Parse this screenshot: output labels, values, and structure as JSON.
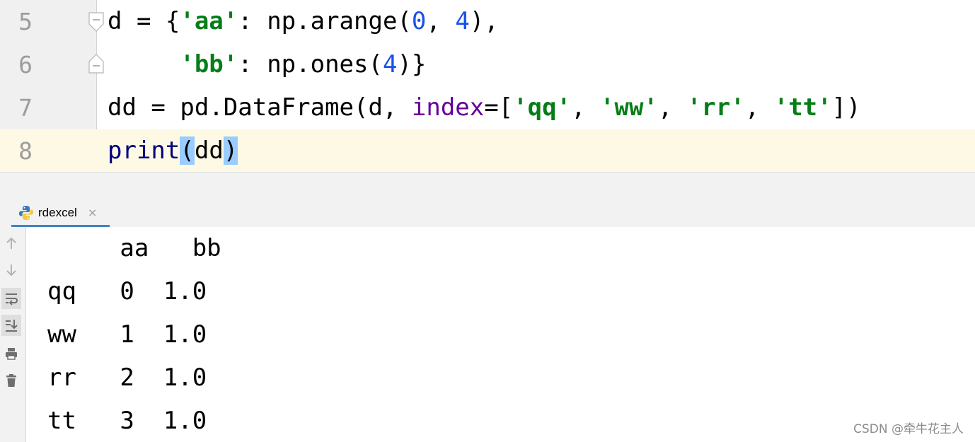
{
  "editor": {
    "lines": [
      {
        "number": "5",
        "tokens": {
          "a": "d = {",
          "b": "'aa'",
          "c": ": np.arange(",
          "d": "0",
          "e": ", ",
          "f": "4",
          "g": "),"
        }
      },
      {
        "number": "6",
        "tokens": {
          "a": "     ",
          "b": "'bb'",
          "c": ": np.ones(",
          "d": "4",
          "e": ")}"
        }
      },
      {
        "number": "7",
        "tokens": {
          "a": "dd = pd.DataFrame(d, ",
          "b": "index",
          "c": "=[",
          "d": "'qq'",
          "e": ", ",
          "f": "'ww'",
          "g": ", ",
          "h": "'rr'",
          "i": ", ",
          "j": "'tt'",
          "k": "])"
        }
      },
      {
        "number": "8",
        "tokens": {
          "a": "print",
          "b": "(",
          "c": "dd",
          "d": ")"
        }
      }
    ]
  },
  "run": {
    "tab_label": "rdexcel",
    "tab_close": "×",
    "output": [
      "     aa   bb",
      "qq   0  1.0",
      "ww   1  1.0",
      "rr   2  1.0",
      "tt   3  1.0"
    ]
  },
  "toolbar_icons": [
    "up-arrow-icon",
    "down-arrow-icon",
    "soft-wrap-icon",
    "scroll-to-end-icon",
    "print-icon",
    "trash-icon"
  ],
  "watermark": "CSDN @牵牛花主人",
  "colors": {
    "string": "#067d17",
    "number": "#1750eb",
    "keyword_arg": "#660099",
    "builtin": "#000080",
    "current_line": "#fdf9e4",
    "brace_match": "#99ccff",
    "tab_underline": "#4083c9"
  }
}
